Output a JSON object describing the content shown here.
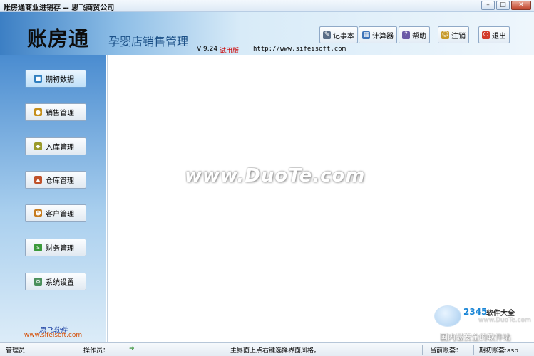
{
  "window": {
    "title": "账房通商业进销存 -- 思飞商贸公司",
    "min_label": "–",
    "max_label": "□",
    "close_label": "✕"
  },
  "header": {
    "logo": "账房通",
    "subtitle": "孕婴店销售管理",
    "version": "V 9.24",
    "trial": "试用版",
    "url": "http://www.sifeisoft.com"
  },
  "toolbar": {
    "notepad": "记事本",
    "calculator": "计算器",
    "help": "帮助",
    "logout": "注销",
    "exit": "退出"
  },
  "sidebar": {
    "items": [
      {
        "label": "期初数据",
        "icon": "book-icon"
      },
      {
        "label": "销售管理",
        "icon": "cart-icon"
      },
      {
        "label": "入库管理",
        "icon": "box-icon"
      },
      {
        "label": "仓库管理",
        "icon": "warehouse-icon"
      },
      {
        "label": "客户管理",
        "icon": "users-icon"
      },
      {
        "label": "财务管理",
        "icon": "money-icon"
      },
      {
        "label": "系统设置",
        "icon": "gear-icon"
      }
    ],
    "active_index": 0,
    "brand_name": "思飞软件",
    "brand_url": "www.sifeisoft.com"
  },
  "main": {
    "watermark": "www.DuoTe.com"
  },
  "overlay_logo": {
    "num": "2345",
    "text": "软件大全",
    "url": "www.DuoTe.com",
    "slogan": "国内最安全的软件站"
  },
  "status": {
    "user": "管理员",
    "operator_label": "操作员：",
    "hint": "主界面上点右键选择界面风格。",
    "account_label": "当前账套：",
    "period": "期初账套:asp"
  },
  "colors": {
    "header_blue": "#3c7fc4",
    "sidebar_blue": "#4a8cd0",
    "trial_red": "#c00000",
    "brand_orange": "#d54b00"
  }
}
